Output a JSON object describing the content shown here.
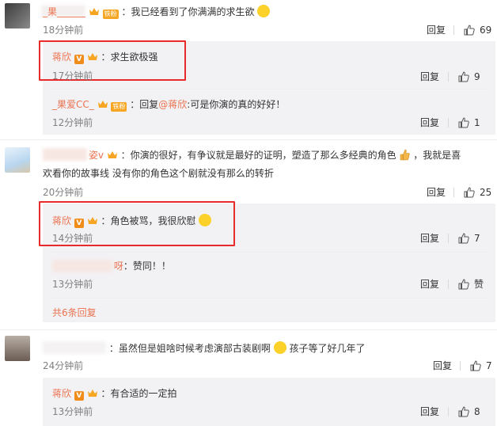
{
  "comments": [
    {
      "user": "_果______",
      "text": "：我已经看到了你满满的求生欲",
      "time": "18分钟前",
      "reply_label": "回复",
      "likes": "69",
      "sub": [
        {
          "user": "蒋欣",
          "text": "：求生欲极强",
          "time": "17分钟前",
          "reply_label": "回复",
          "likes": "9"
        },
        {
          "user": "_果爱CC_",
          "prefix": "：回复",
          "mention": "@蒋欣",
          "text": ":可是你演的真的好好！",
          "time": "12分钟前",
          "reply_label": "回复",
          "likes": "1"
        }
      ]
    },
    {
      "user": "姿v",
      "text_line1": "：你演的很好，有争议就是最好的证明，塑造了那么多经典的角色",
      "text_line1b": "，我就是喜",
      "text_line2": "欢看你的故事线 没有你的角色这个剧就没有那么的转折",
      "time": "20分钟前",
      "reply_label": "回复",
      "likes": "25",
      "sub": [
        {
          "user": "蒋欣",
          "text": "：角色被骂，我很欣慰",
          "time": "14分钟前",
          "reply_label": "回复",
          "likes": "7"
        },
        {
          "user": "呀",
          "text": "：赞同！！",
          "time": "13分钟前",
          "reply_label": "回复",
          "likes": "赞"
        }
      ],
      "more_label": "共6条回复"
    },
    {
      "user": "",
      "text": "：虽然但是姐啥时候考虑演部古装剧啊",
      "text_tail": "孩子等了好几年了",
      "time": "24分钟前",
      "reply_label": "回复",
      "likes": "7",
      "sub": [
        {
          "user": "蒋欣",
          "text": "：有合适的一定拍",
          "time": "13分钟前",
          "reply_label": "回复",
          "likes": "8"
        }
      ]
    }
  ],
  "badges": {
    "v": "V",
    "fan": "铁粉"
  },
  "colors": {
    "username": "#eb7350",
    "highlight_box": "#e82a2a",
    "sub_bg": "#f2f2f5"
  }
}
